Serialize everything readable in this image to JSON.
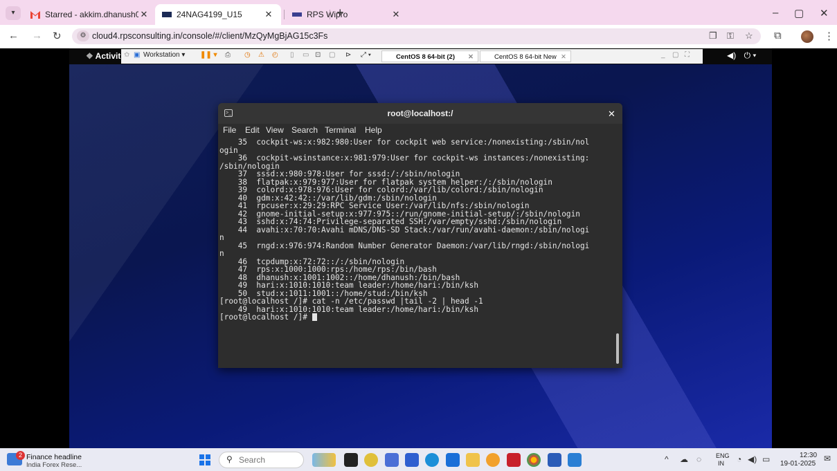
{
  "browser": {
    "tabs": [
      {
        "label": "Starred - akkim.dhanush03@gn",
        "close": "✕"
      },
      {
        "label": "24NAG4199_U15",
        "close": "✕"
      },
      {
        "label": "RPS Wipro",
        "close": "✕"
      }
    ],
    "new_tab": "+",
    "url": "cloud4.rpsconsulting.in/console/#/client/MzQyMgBjAG15c3Fs",
    "colors": {
      "tab_strip": "#f5d9ee",
      "omnibox": "#f1e4ef"
    }
  },
  "gnome": {
    "activities": "Activities",
    "vm_menu": "Workstation ▾",
    "vm_tabs": [
      "CentOS 8 64-bit (2)",
      "CentOS 8 64-bit New"
    ]
  },
  "terminal": {
    "title": "root@localhost:/",
    "menu": [
      "File",
      "Edit",
      "View",
      "Search",
      "Terminal",
      "Help"
    ],
    "lines": [
      "    35  cockpit-ws:x:982:980:User for cockpit web service:/nonexisting:/sbin/nol",
      "ogin",
      "    36  cockpit-wsinstance:x:981:979:User for cockpit-ws instances:/nonexisting:",
      "/sbin/nologin",
      "    37  sssd:x:980:978:User for sssd:/:/sbin/nologin",
      "    38  flatpak:x:979:977:User for flatpak system helper:/:/sbin/nologin",
      "    39  colord:x:978:976:User for colord:/var/lib/colord:/sbin/nologin",
      "    40  gdm:x:42:42::/var/lib/gdm:/sbin/nologin",
      "    41  rpcuser:x:29:29:RPC Service User:/var/lib/nfs:/sbin/nologin",
      "    42  gnome-initial-setup:x:977:975::/run/gnome-initial-setup/:/sbin/nologin",
      "    43  sshd:x:74:74:Privilege-separated SSH:/var/empty/sshd:/sbin/nologin",
      "    44  avahi:x:70:70:Avahi mDNS/DNS-SD Stack:/var/run/avahi-daemon:/sbin/nologi",
      "n",
      "    45  rngd:x:976:974:Random Number Generator Daemon:/var/lib/rngd:/sbin/nologi",
      "n",
      "    46  tcpdump:x:72:72::/:/sbin/nologin",
      "    47  rps:x:1000:1000:rps:/home/rps:/bin/bash",
      "    48  dhanush:x:1001:1002::/home/dhanush:/bin/bash",
      "    49  hari:x:1010:1010:team leader:/home/hari:/bin/ksh",
      "    50  stud:x:1011:1001::/home/stud:/bin/ksh",
      "[root@localhost /]# cat -n /etc/passwd |tail -2 | head -1",
      "    49  hari:x:1010:1010:team leader:/home/hari:/bin/ksh",
      "[root@localhost /]# "
    ]
  },
  "taskbar": {
    "news_title": "Finance headline",
    "news_sub": "India Forex Rese...",
    "news_badge": "2",
    "search_placeholder": "Search",
    "lang_top": "ENG",
    "lang_bottom": "IN",
    "time": "12:30",
    "date": "19-01-2025"
  }
}
